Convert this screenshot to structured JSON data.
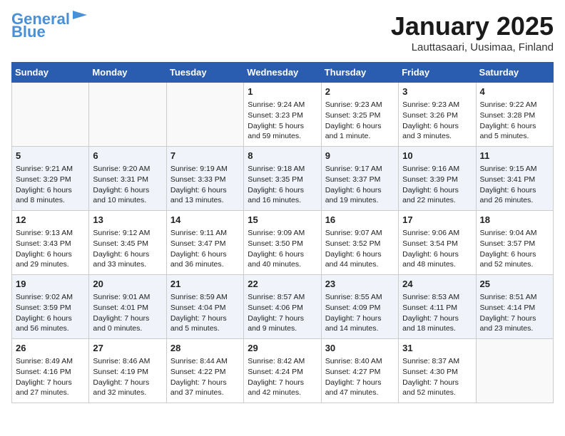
{
  "header": {
    "logo_line1": "General",
    "logo_line2": "Blue",
    "month": "January 2025",
    "location": "Lauttasaari, Uusimaa, Finland"
  },
  "days_of_week": [
    "Sunday",
    "Monday",
    "Tuesday",
    "Wednesday",
    "Thursday",
    "Friday",
    "Saturday"
  ],
  "weeks": [
    [
      {
        "day": "",
        "info": ""
      },
      {
        "day": "",
        "info": ""
      },
      {
        "day": "",
        "info": ""
      },
      {
        "day": "1",
        "info": "Sunrise: 9:24 AM\nSunset: 3:23 PM\nDaylight: 5 hours\nand 59 minutes."
      },
      {
        "day": "2",
        "info": "Sunrise: 9:23 AM\nSunset: 3:25 PM\nDaylight: 6 hours\nand 1 minute."
      },
      {
        "day": "3",
        "info": "Sunrise: 9:23 AM\nSunset: 3:26 PM\nDaylight: 6 hours\nand 3 minutes."
      },
      {
        "day": "4",
        "info": "Sunrise: 9:22 AM\nSunset: 3:28 PM\nDaylight: 6 hours\nand 5 minutes."
      }
    ],
    [
      {
        "day": "5",
        "info": "Sunrise: 9:21 AM\nSunset: 3:29 PM\nDaylight: 6 hours\nand 8 minutes."
      },
      {
        "day": "6",
        "info": "Sunrise: 9:20 AM\nSunset: 3:31 PM\nDaylight: 6 hours\nand 10 minutes."
      },
      {
        "day": "7",
        "info": "Sunrise: 9:19 AM\nSunset: 3:33 PM\nDaylight: 6 hours\nand 13 minutes."
      },
      {
        "day": "8",
        "info": "Sunrise: 9:18 AM\nSunset: 3:35 PM\nDaylight: 6 hours\nand 16 minutes."
      },
      {
        "day": "9",
        "info": "Sunrise: 9:17 AM\nSunset: 3:37 PM\nDaylight: 6 hours\nand 19 minutes."
      },
      {
        "day": "10",
        "info": "Sunrise: 9:16 AM\nSunset: 3:39 PM\nDaylight: 6 hours\nand 22 minutes."
      },
      {
        "day": "11",
        "info": "Sunrise: 9:15 AM\nSunset: 3:41 PM\nDaylight: 6 hours\nand 26 minutes."
      }
    ],
    [
      {
        "day": "12",
        "info": "Sunrise: 9:13 AM\nSunset: 3:43 PM\nDaylight: 6 hours\nand 29 minutes."
      },
      {
        "day": "13",
        "info": "Sunrise: 9:12 AM\nSunset: 3:45 PM\nDaylight: 6 hours\nand 33 minutes."
      },
      {
        "day": "14",
        "info": "Sunrise: 9:11 AM\nSunset: 3:47 PM\nDaylight: 6 hours\nand 36 minutes."
      },
      {
        "day": "15",
        "info": "Sunrise: 9:09 AM\nSunset: 3:50 PM\nDaylight: 6 hours\nand 40 minutes."
      },
      {
        "day": "16",
        "info": "Sunrise: 9:07 AM\nSunset: 3:52 PM\nDaylight: 6 hours\nand 44 minutes."
      },
      {
        "day": "17",
        "info": "Sunrise: 9:06 AM\nSunset: 3:54 PM\nDaylight: 6 hours\nand 48 minutes."
      },
      {
        "day": "18",
        "info": "Sunrise: 9:04 AM\nSunset: 3:57 PM\nDaylight: 6 hours\nand 52 minutes."
      }
    ],
    [
      {
        "day": "19",
        "info": "Sunrise: 9:02 AM\nSunset: 3:59 PM\nDaylight: 6 hours\nand 56 minutes."
      },
      {
        "day": "20",
        "info": "Sunrise: 9:01 AM\nSunset: 4:01 PM\nDaylight: 7 hours\nand 0 minutes."
      },
      {
        "day": "21",
        "info": "Sunrise: 8:59 AM\nSunset: 4:04 PM\nDaylight: 7 hours\nand 5 minutes."
      },
      {
        "day": "22",
        "info": "Sunrise: 8:57 AM\nSunset: 4:06 PM\nDaylight: 7 hours\nand 9 minutes."
      },
      {
        "day": "23",
        "info": "Sunrise: 8:55 AM\nSunset: 4:09 PM\nDaylight: 7 hours\nand 14 minutes."
      },
      {
        "day": "24",
        "info": "Sunrise: 8:53 AM\nSunset: 4:11 PM\nDaylight: 7 hours\nand 18 minutes."
      },
      {
        "day": "25",
        "info": "Sunrise: 8:51 AM\nSunset: 4:14 PM\nDaylight: 7 hours\nand 23 minutes."
      }
    ],
    [
      {
        "day": "26",
        "info": "Sunrise: 8:49 AM\nSunset: 4:16 PM\nDaylight: 7 hours\nand 27 minutes."
      },
      {
        "day": "27",
        "info": "Sunrise: 8:46 AM\nSunset: 4:19 PM\nDaylight: 7 hours\nand 32 minutes."
      },
      {
        "day": "28",
        "info": "Sunrise: 8:44 AM\nSunset: 4:22 PM\nDaylight: 7 hours\nand 37 minutes."
      },
      {
        "day": "29",
        "info": "Sunrise: 8:42 AM\nSunset: 4:24 PM\nDaylight: 7 hours\nand 42 minutes."
      },
      {
        "day": "30",
        "info": "Sunrise: 8:40 AM\nSunset: 4:27 PM\nDaylight: 7 hours\nand 47 minutes."
      },
      {
        "day": "31",
        "info": "Sunrise: 8:37 AM\nSunset: 4:30 PM\nDaylight: 7 hours\nand 52 minutes."
      },
      {
        "day": "",
        "info": ""
      }
    ]
  ]
}
